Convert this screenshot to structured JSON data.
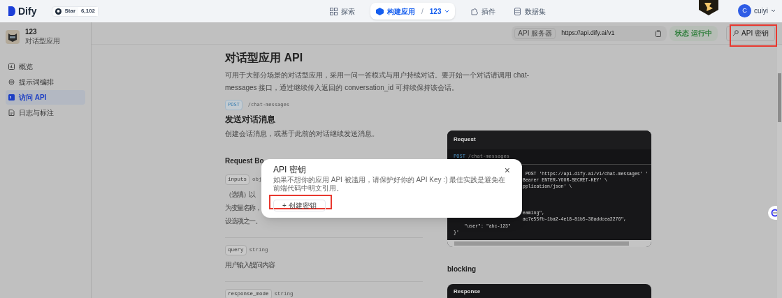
{
  "nav": {
    "logo": "Dify",
    "star_label": "Star",
    "star_count": "6,102",
    "tabs": [
      {
        "label": "探索",
        "kind": "explore",
        "selected": false
      },
      {
        "label": "构建应用",
        "kind": "build",
        "selected": true,
        "separator": "/",
        "sub": "123"
      },
      {
        "label": "插件",
        "kind": "plugin",
        "selected": false
      },
      {
        "label": "数据集",
        "kind": "dataset",
        "selected": false
      }
    ],
    "user": {
      "initial": "C",
      "name": "cuiyi"
    }
  },
  "sidebar": {
    "app_name": "123",
    "app_type": "对话型应用",
    "items": [
      {
        "label": "概览",
        "kind": "overview",
        "selected": false
      },
      {
        "label": "提示词编排",
        "kind": "prompt",
        "selected": false
      },
      {
        "label": "访问 API",
        "kind": "api",
        "selected": true
      },
      {
        "label": "日志与标注",
        "kind": "logs",
        "selected": false
      }
    ]
  },
  "header": {
    "server_label": "API 服务器",
    "server_url": "https://api.dify.ai/v1",
    "status": "状态 运行中",
    "api_key_button": "API 密钥"
  },
  "doc": {
    "title": "对话型应用 API",
    "intro": "可用于大部分场景的对话型应用，采用一问一答模式与用户持续对话。要开始一个对话请调用 chat-messages 接口，通过继续传入返回的 conversation_id 可持续保持该会话。",
    "method": "POST",
    "path": "/chat-messages",
    "section_title": "发送对话消息",
    "section_desc": "创建会话消息，或基于此前的对话继续发送消息。",
    "body_heading": "Request Bo",
    "params": [
      {
        "name": "inputs",
        "type": "obj",
        "lines": [
          "（选填）以",
          "为变量名称，",
          "设选项之一。"
        ]
      },
      {
        "name": "query",
        "type": "string",
        "lines": [
          "用户输入/提问内容"
        ]
      },
      {
        "name": "response_mode",
        "type": "string"
      }
    ]
  },
  "request_panel": {
    "title": "Request",
    "method": "POST",
    "path": "/chat-messages",
    "lines": [
      {
        "text": " POST 'https://api.dify.ai/v1/chat-messages' '",
        "kind": "clipped"
      },
      {
        "text": "Bearer ENTER-YOUR-SECRET-KEY' \\",
        "kind": "clipped"
      },
      {
        "text": "pplication/json' \\",
        "kind": "clipped"
      },
      {
        "text": "eaming\",",
        "kind": "clipped"
      },
      {
        "text": "ac7e55fb-1ba2-4e18-81b5-38addcea2276\",",
        "kind": "clipped"
      },
      {
        "text": "    \"user\": \"abc-123\"",
        "kind": "full"
      },
      {
        "text": "}'",
        "kind": "full"
      }
    ]
  },
  "blocking_heading": "blocking",
  "response_panel": {
    "title": "Response"
  },
  "modal": {
    "title": "API 密钥",
    "description": "如果不想你的应用 API 被滥用，请保护好你的 API Key :) 最佳实践是避免在前端代码中明文引用。",
    "close": "×",
    "create_button": "+ 创建密钥"
  }
}
